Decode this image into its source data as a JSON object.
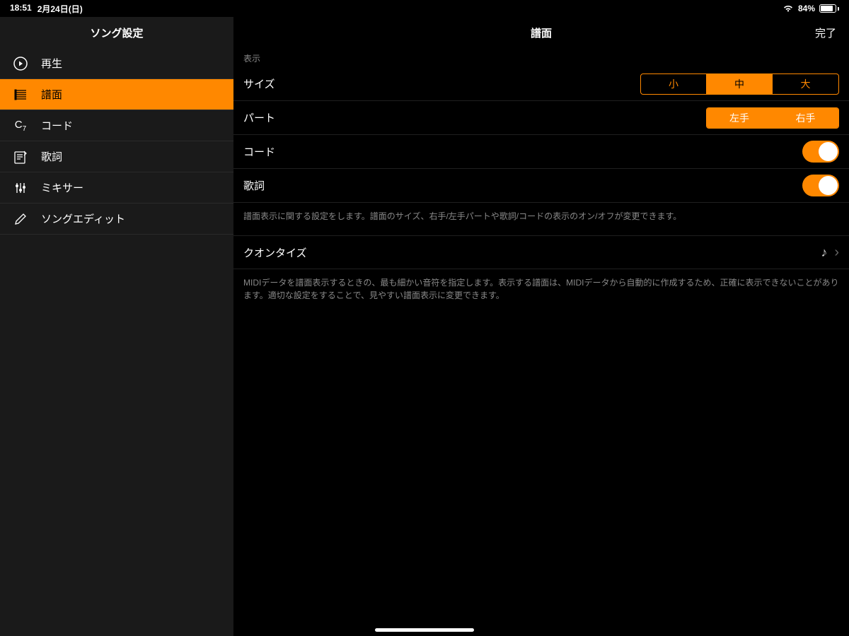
{
  "status": {
    "time": "18:51",
    "date": "2月24日(日)",
    "battery_pct": "84%"
  },
  "sidebar": {
    "title": "ソング設定",
    "items": [
      {
        "label": "再生"
      },
      {
        "label": "譜面"
      },
      {
        "label": "コード"
      },
      {
        "label": "歌詞"
      },
      {
        "label": "ミキサー"
      },
      {
        "label": "ソングエディット"
      }
    ]
  },
  "main": {
    "title": "譜面",
    "done": "完了",
    "display_section": "表示",
    "rows": {
      "size": {
        "label": "サイズ",
        "options": [
          "小",
          "中",
          "大"
        ],
        "selected": 1
      },
      "part": {
        "label": "パート",
        "options": [
          "左手",
          "右手"
        ]
      },
      "chord": {
        "label": "コード"
      },
      "lyrics": {
        "label": "歌詞"
      }
    },
    "display_help": "譜面表示に関する設定をします。譜面のサイズ、右手/左手パートや歌詞/コードの表示のオン/オフが変更できます。",
    "quantize": {
      "label": "クオンタイズ"
    },
    "quantize_help": "MIDIデータを譜面表示するときの、最も細かい音符を指定します。表示する譜面は、MIDIデータから自動的に作成するため、正確に表示できないことがあります。適切な設定をすることで、見やすい譜面表示に変更できます。"
  }
}
